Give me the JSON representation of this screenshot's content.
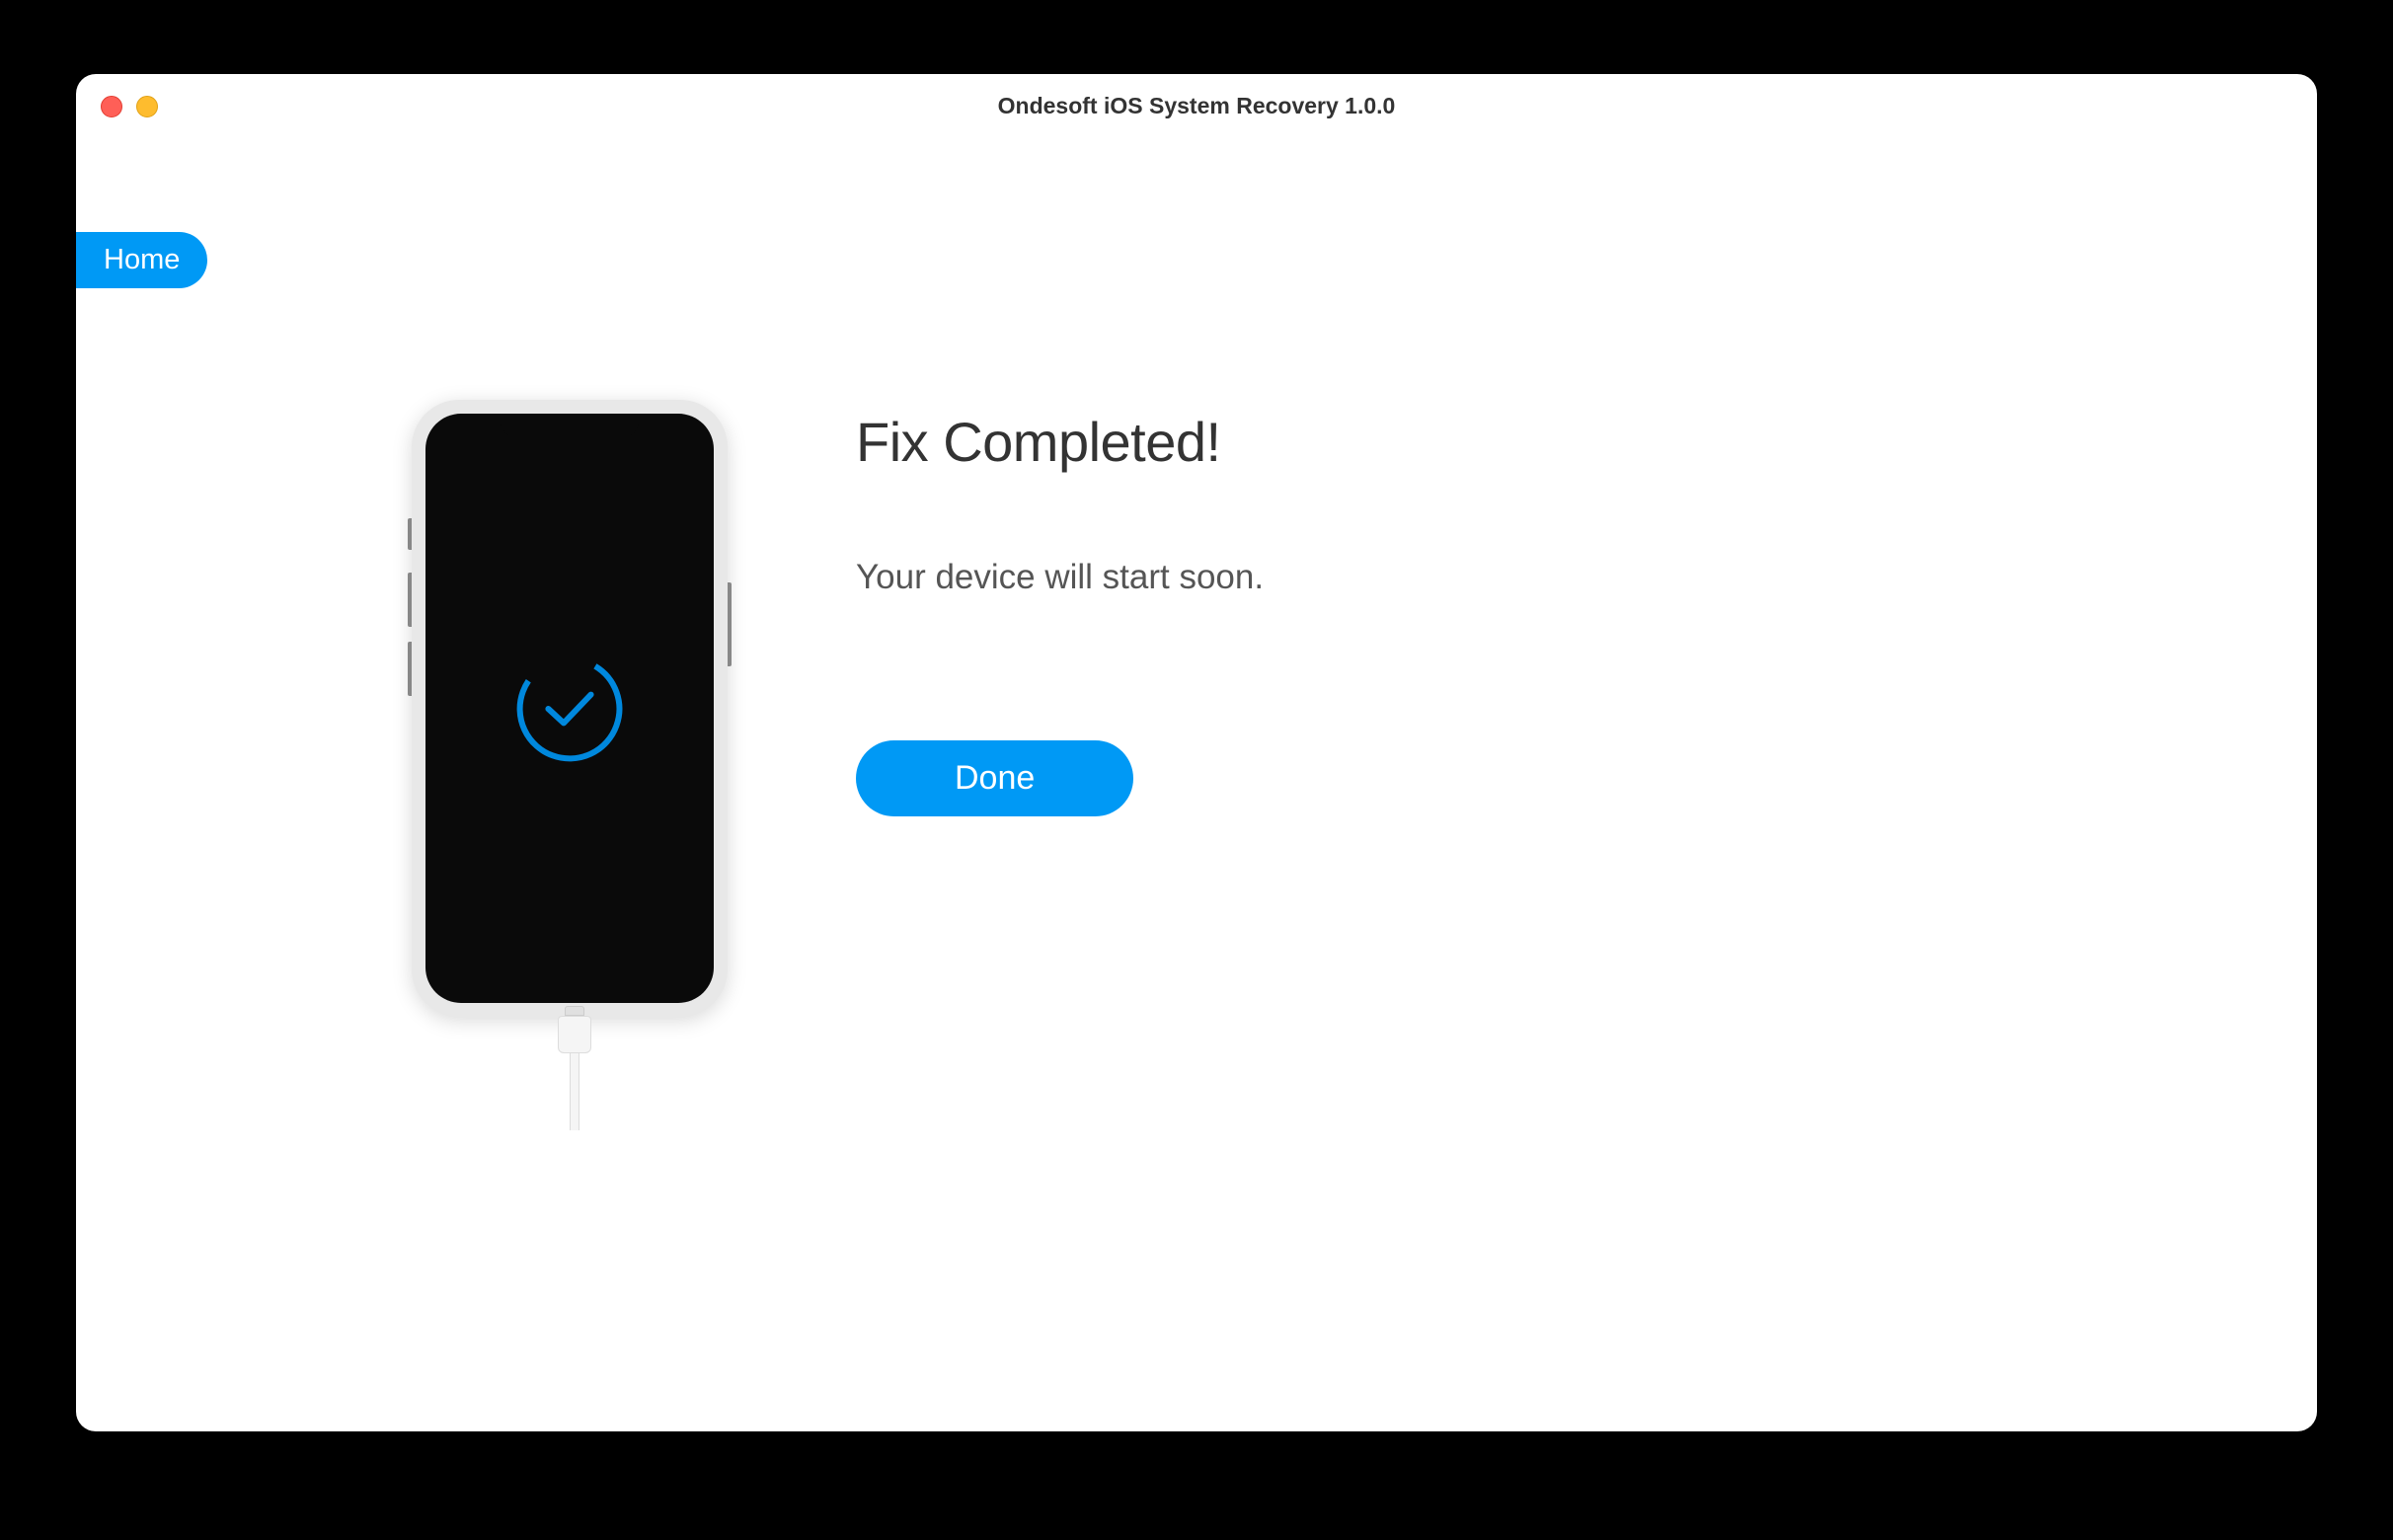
{
  "window": {
    "title": "Ondesoft iOS System Recovery 1.0.0"
  },
  "nav": {
    "home_label": "Home"
  },
  "main": {
    "heading": "Fix Completed!",
    "subtext": "Your device will start soon.",
    "done_label": "Done"
  },
  "colors": {
    "primary": "#0099f5",
    "text_dark": "#333333",
    "text_medium": "#555555"
  }
}
